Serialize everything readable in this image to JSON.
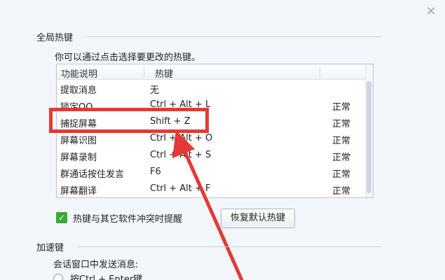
{
  "window": {
    "close_glyph": "×"
  },
  "global_hotkeys": {
    "title": "全局热键",
    "hint": "你可以通过点击选择要更改的热键。",
    "columns": {
      "function": "功能说明",
      "hotkey": "热键"
    },
    "rows": [
      {
        "function": "提取消息",
        "hotkey": "无",
        "status": ""
      },
      {
        "function": "锁定QQ",
        "hotkey": "Ctrl + Alt + L",
        "status": "正常"
      },
      {
        "function": "捕捉屏幕",
        "hotkey": "Shift + Z",
        "status": "正常"
      },
      {
        "function": "屏幕识图",
        "hotkey": "Ctrl + Alt + O",
        "status": "正常"
      },
      {
        "function": "屏幕录制",
        "hotkey": "Ctrl + Alt + S",
        "status": "正常"
      },
      {
        "function": "群通话按住发言",
        "hotkey": "F6",
        "status": "正常"
      },
      {
        "function": "屏幕翻译",
        "hotkey": "Ctrl + Alt + F",
        "status": "正常"
      }
    ],
    "conflict_checkbox": {
      "label": "热键与其它软件冲突时提醒",
      "checked": true
    },
    "reset_button": "恢复默认热键"
  },
  "accelerators": {
    "title": "加速键",
    "send_label": "会话窗口中发送消息:",
    "option_ctrl_enter": "按Ctrl + Enter键"
  },
  "colors": {
    "highlight": "#e53935",
    "check": "#3aaa35"
  }
}
